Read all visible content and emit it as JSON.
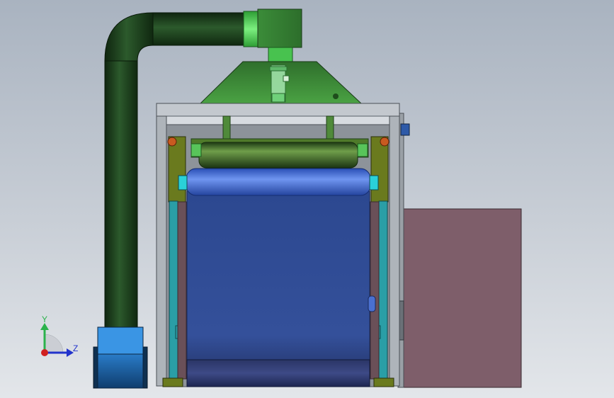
{
  "viewport": {
    "background_top": "#a9b3c0",
    "background_bottom": "#e3e6ea"
  },
  "colors": {
    "duct_green": "#1d3a1d",
    "duct_bright_green": "#4fd65a",
    "hood_green": "#3f8f3a",
    "frame_gray": "#b9bec4",
    "frame_dark": "#5a6068",
    "roller_green": "#3d6b2c",
    "belt_blue": "#2f4a8e",
    "drum_blue": "#4a73d8",
    "teal_post": "#2aa0a8",
    "side_panel": "#7e5e6a",
    "fan_blue": "#3a8fe0",
    "axis_y": "#2bb24c",
    "axis_z": "#2233cc",
    "axis_x": "#d02020"
  },
  "triad": {
    "y_label": "Y",
    "z_label": "Z"
  }
}
